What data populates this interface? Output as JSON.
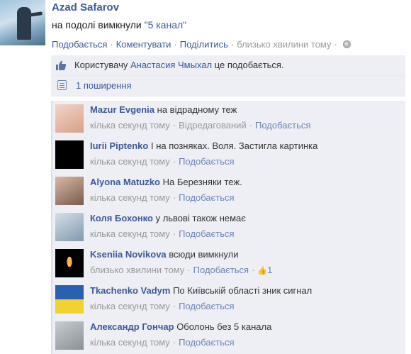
{
  "post": {
    "author": "Azad Safarov",
    "text_prefix": "на подолі вимкнули ",
    "text_quote": "\"5 канал\"",
    "actions": {
      "like": "Подобається",
      "comment": "Коментувати",
      "share": "Поділитись",
      "time": "близько хвилини тому"
    }
  },
  "likes": {
    "prefix": "Користувачу ",
    "user": "Анастасия Чмыхал",
    "suffix": " це подобається."
  },
  "shares": {
    "label": "1 поширення"
  },
  "comments": [
    {
      "name": "Mazur Evgenia",
      "text": "на відрадному теж",
      "time": "кілька секунд тому",
      "edited": "Відредагований",
      "like": "Подобається",
      "avatar_colors": [
        "#d8a087",
        "#f0d6c9"
      ]
    },
    {
      "name": "Iurii Piptenko",
      "text": "І на позняках. Воля. Застигла картинка",
      "time": "кілька секунд тому",
      "like": "Подобається",
      "avatar_colors": [
        "#000000",
        "#000000"
      ]
    },
    {
      "name": "Alyona Matuzko",
      "text": "На Березняки теж.",
      "time": "кілька секунд тому",
      "like": "Подобається",
      "avatar_colors": [
        "#7a5a4a",
        "#d9b8a6"
      ]
    },
    {
      "name": "Коля Бохонко",
      "text": "у львові також немає",
      "time": "кілька секунд тому",
      "like": "Подобається",
      "avatar_colors": [
        "#7f9ab0",
        "#d6dfe6"
      ]
    },
    {
      "name": "Kseniia Novikova",
      "text": "всюди вимкнули",
      "time": "близько хвилини тому",
      "like": "Подобається",
      "like_count": "1",
      "avatar_colors": [
        "#000000",
        "#ffb347"
      ]
    },
    {
      "name": "Tkachenko Vadym",
      "text": "По Київській області зник сигнал",
      "time": "кілька секунд тому",
      "like": "Подобається",
      "avatar_colors": [
        "#2b5fb0",
        "#f2d22e"
      ]
    },
    {
      "name": "Александр Гончар",
      "text": "Оболонь без 5 канала",
      "time": "кілька секунд тому",
      "like": "Подобається",
      "avatar_colors": [
        "#8a9196",
        "#c7cdd1"
      ]
    }
  ],
  "colors": {
    "link": "#3b5998",
    "ufi_bg": "#edeff4",
    "meta": "#999999"
  },
  "icons": {
    "like": "thumbs-up-icon",
    "share": "share-list-icon",
    "privacy": "globe-icon"
  }
}
